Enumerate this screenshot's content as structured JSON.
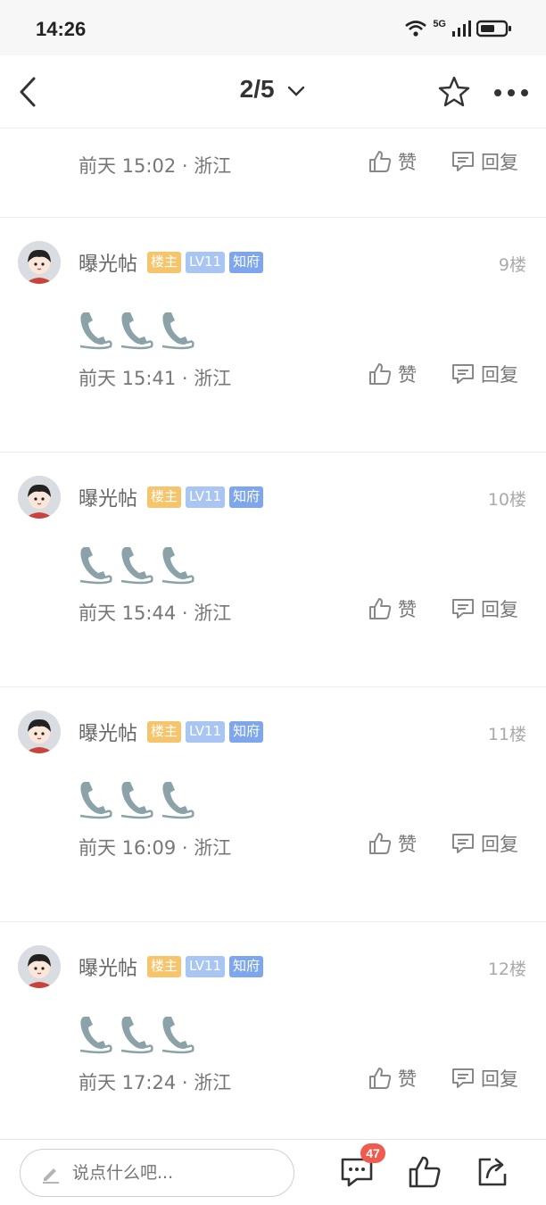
{
  "status": {
    "time": "14:26",
    "network": "5G"
  },
  "header": {
    "page_indicator": "2/5"
  },
  "previous_post": {
    "time_location": "前天 15:02 · 浙江",
    "like_label": "赞",
    "reply_label": "回复"
  },
  "posts": [
    {
      "username": "曝光帖",
      "badges": [
        "楼主",
        "LV11",
        "知府"
      ],
      "floor": "9楼",
      "time_location": "前天 15:41 · 浙江",
      "like_label": "赞",
      "reply_label": "回复"
    },
    {
      "username": "曝光帖",
      "badges": [
        "楼主",
        "LV11",
        "知府"
      ],
      "floor": "10楼",
      "time_location": "前天 15:44 · 浙江",
      "like_label": "赞",
      "reply_label": "回复"
    },
    {
      "username": "曝光帖",
      "badges": [
        "楼主",
        "LV11",
        "知府"
      ],
      "floor": "11楼",
      "time_location": "前天 16:09 · 浙江",
      "like_label": "赞",
      "reply_label": "回复"
    },
    {
      "username": "曝光帖",
      "badges": [
        "楼主",
        "LV11",
        "知府"
      ],
      "floor": "12楼",
      "time_location": "前天 17:24 · 浙江",
      "like_label": "赞",
      "reply_label": "回复"
    }
  ],
  "bottom": {
    "input_placeholder": "说点什么吧...",
    "comment_count": "47"
  },
  "colors": {
    "owner_badge": "#f6c46a",
    "level_badge": "#a9c5f3",
    "rank_badge": "#7ea6ec",
    "count_badge": "#f05a4f"
  }
}
